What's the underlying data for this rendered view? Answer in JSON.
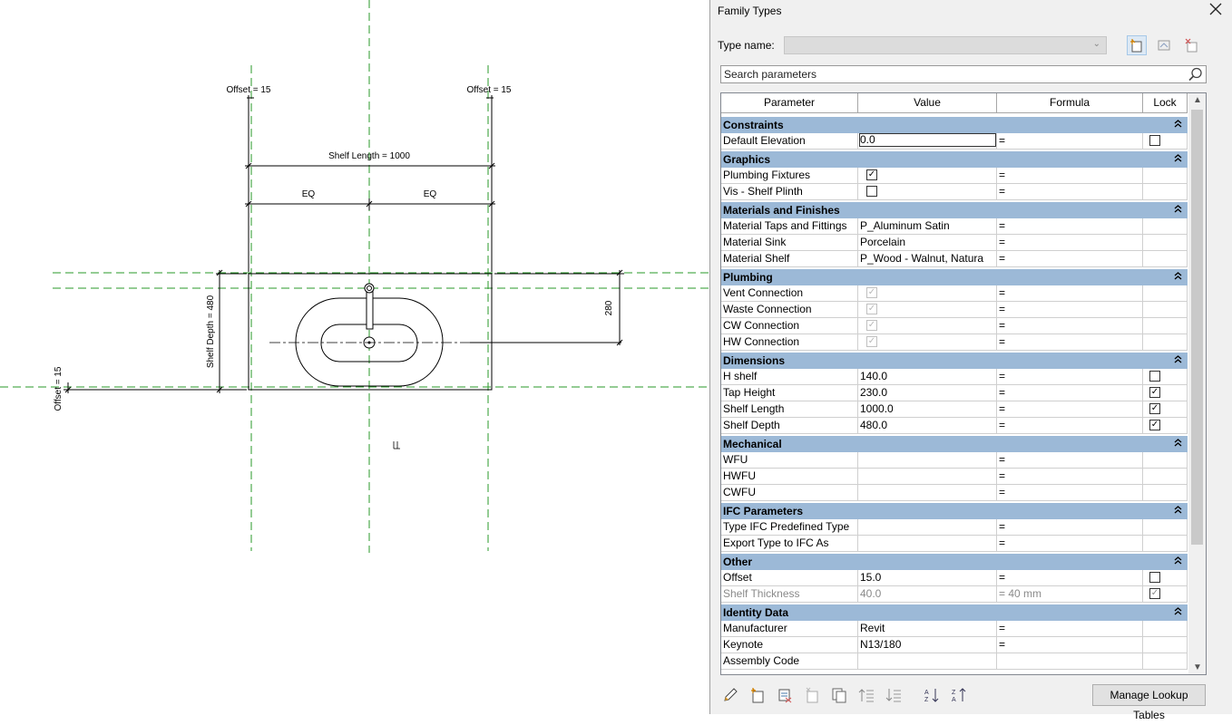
{
  "drawing": {
    "offset_top_left": "Offset = 15",
    "offset_top_right": "Offset = 15",
    "offset_left": "Offset = 15",
    "shelf_length": "Shelf Length = 1000",
    "eq_left": "EQ",
    "eq_right": "EQ",
    "shelf_depth": "Shelf Depth = 480",
    "dim_280": "280"
  },
  "dialog": {
    "title": "Family Types",
    "type_name_label": "Type name:",
    "search_placeholder": "Search parameters",
    "columns": [
      "Parameter",
      "Value",
      "Formula",
      "Lock"
    ],
    "lookup_button": "Manage Lookup Tables",
    "groups": [
      {
        "name": "Constraints",
        "rows": [
          {
            "param": "Default Elevation",
            "value": "0.0",
            "formula": "=",
            "lock": "unchecked",
            "editing": true
          }
        ]
      },
      {
        "name": "Graphics",
        "rows": [
          {
            "param": "Plumbing Fixtures",
            "value_check": "checked",
            "formula": "=",
            "lock": "none"
          },
          {
            "param": "Vis - Shelf Plinth",
            "value_check": "unchecked",
            "formula": "=",
            "lock": "none"
          }
        ]
      },
      {
        "name": "Materials and Finishes",
        "rows": [
          {
            "param": "Material Taps and Fittings",
            "value": "P_Aluminum Satin",
            "formula": "=",
            "lock": "none"
          },
          {
            "param": "Material Sink",
            "value": "Porcelain",
            "formula": "=",
            "lock": "none"
          },
          {
            "param": "Material Shelf",
            "value": "P_Wood - Walnut, Natura",
            "formula": "=",
            "lock": "none"
          }
        ]
      },
      {
        "name": "Plumbing",
        "rows": [
          {
            "param": "Vent Connection",
            "value_check": "disabled",
            "formula": "=",
            "lock": "none"
          },
          {
            "param": "Waste Connection",
            "value_check": "disabled",
            "formula": "=",
            "lock": "none"
          },
          {
            "param": "CW Connection",
            "value_check": "disabled",
            "formula": "=",
            "lock": "none"
          },
          {
            "param": "HW Connection",
            "value_check": "disabled",
            "formula": "=",
            "lock": "none"
          }
        ]
      },
      {
        "name": "Dimensions",
        "rows": [
          {
            "param": "H shelf",
            "value": "140.0",
            "formula": "=",
            "lock": "unchecked"
          },
          {
            "param": "Tap Height",
            "value": "230.0",
            "formula": "=",
            "lock": "checked"
          },
          {
            "param": "Shelf Length",
            "value": "1000.0",
            "formula": "=",
            "lock": "checked"
          },
          {
            "param": "Shelf Depth",
            "value": "480.0",
            "formula": "=",
            "lock": "checked"
          }
        ]
      },
      {
        "name": "Mechanical",
        "rows": [
          {
            "param": "WFU",
            "value": "",
            "formula": "=",
            "lock": "none"
          },
          {
            "param": "HWFU",
            "value": "",
            "formula": "=",
            "lock": "none"
          },
          {
            "param": "CWFU",
            "value": "",
            "formula": "=",
            "lock": "none"
          }
        ]
      },
      {
        "name": "IFC Parameters",
        "rows": [
          {
            "param": "Type IFC Predefined Type",
            "value": "",
            "formula": "=",
            "lock": "none"
          },
          {
            "param": "Export Type to IFC As",
            "value": "",
            "formula": "=",
            "lock": "none"
          }
        ]
      },
      {
        "name": "Other",
        "rows": [
          {
            "param": "Offset",
            "value": "15.0",
            "formula": "=",
            "lock": "unchecked"
          },
          {
            "param": "Shelf Thickness",
            "value": "40.0",
            "formula": "= 40 mm",
            "lock": "checked",
            "grey": true
          }
        ]
      },
      {
        "name": "Identity Data",
        "rows": [
          {
            "param": "Manufacturer",
            "value": "Revit",
            "formula": "=",
            "lock": "none"
          },
          {
            "param": "Keynote",
            "value": "N13/180",
            "formula": "=",
            "lock": "none"
          },
          {
            "param": "Assembly Code",
            "value": "",
            "formula": "",
            "lock": "none"
          }
        ]
      }
    ]
  }
}
